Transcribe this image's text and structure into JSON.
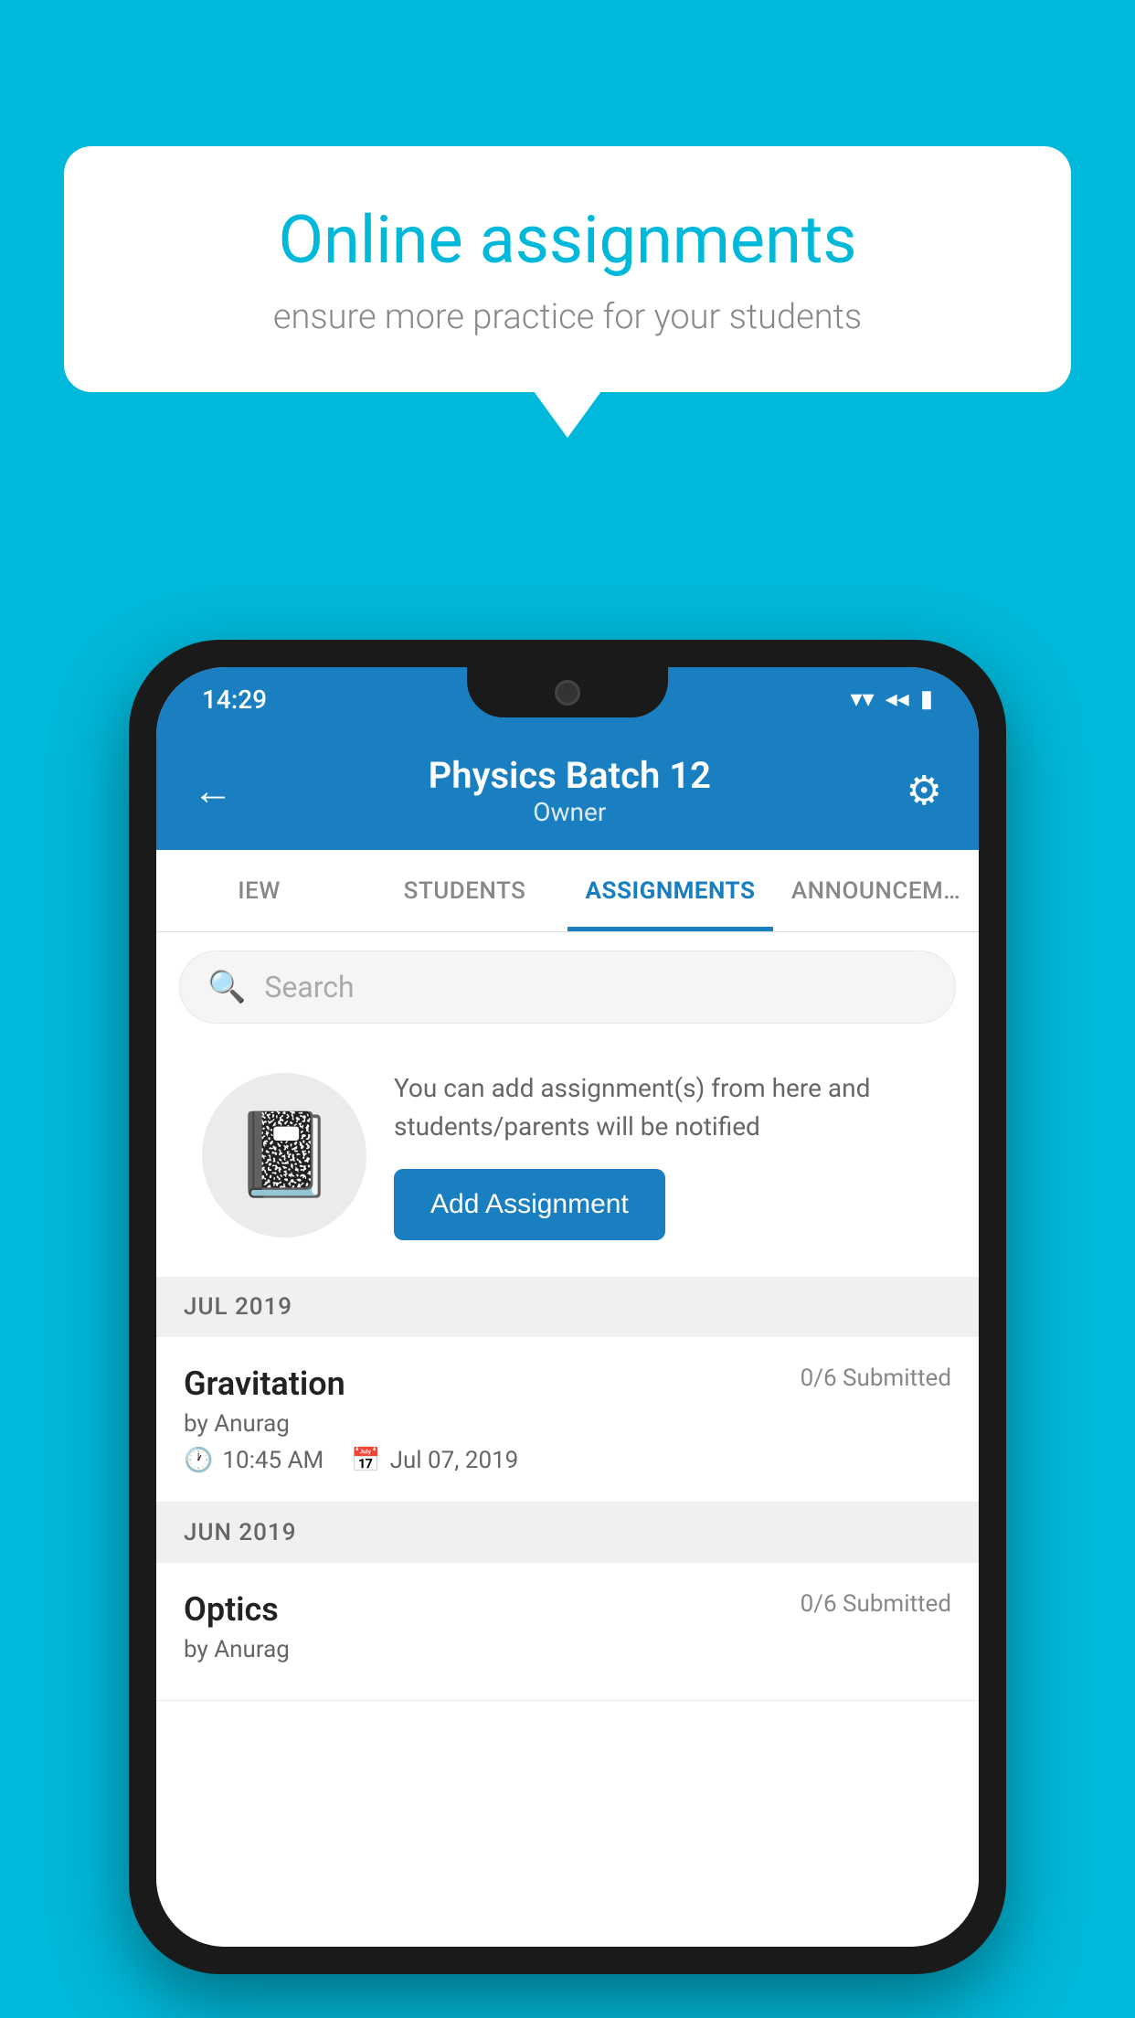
{
  "background_color": "#00b8d9",
  "speech_bubble": {
    "title": "Online assignments",
    "subtitle": "ensure more practice for your students"
  },
  "status_bar": {
    "time": "14:29",
    "wifi_icon": "▾",
    "signal_icon": "◂",
    "battery_icon": "▮"
  },
  "header": {
    "title": "Physics Batch 12",
    "subtitle": "Owner",
    "back_label": "←",
    "settings_label": "⚙"
  },
  "tabs": [
    {
      "id": "overview",
      "label": "IEW",
      "active": false
    },
    {
      "id": "students",
      "label": "STUDENTS",
      "active": false
    },
    {
      "id": "assignments",
      "label": "ASSIGNMENTS",
      "active": true
    },
    {
      "id": "announcements",
      "label": "ANNOUNCEM…",
      "active": false
    }
  ],
  "search": {
    "placeholder": "Search"
  },
  "empty_state": {
    "description": "You can add assignment(s) from here and students/parents will be notified",
    "add_button_label": "Add Assignment"
  },
  "sections": [
    {
      "id": "jul2019",
      "header": "JUL 2019",
      "assignments": [
        {
          "id": "gravitation",
          "name": "Gravitation",
          "submitted": "0/6 Submitted",
          "by": "by Anurag",
          "time": "10:45 AM",
          "date": "Jul 07, 2019"
        }
      ]
    },
    {
      "id": "jun2019",
      "header": "JUN 2019",
      "assignments": [
        {
          "id": "optics",
          "name": "Optics",
          "submitted": "0/6 Submitted",
          "by": "by Anurag",
          "time": "",
          "date": ""
        }
      ]
    }
  ]
}
